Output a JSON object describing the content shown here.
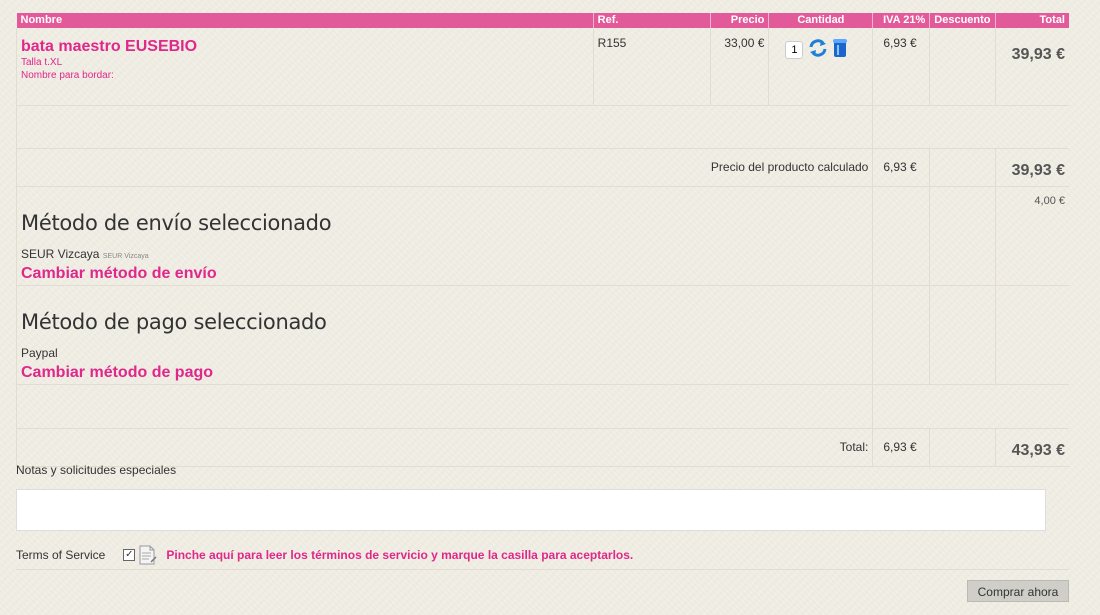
{
  "columns": {
    "name": "Nombre",
    "ref": "Ref.",
    "price": "Precio",
    "qty": "Cantidad",
    "tax": "IVA 21%",
    "discount": "Descuento",
    "total": "Total"
  },
  "product": {
    "name": "bata maestro EUSEBIO",
    "size": "Talla t.XL",
    "embroidery": "Nombre para bordar:",
    "ref": "R155",
    "price": "33,00 €",
    "quantity": "1",
    "tax": "6,93 €",
    "total": "39,93 €"
  },
  "calc": {
    "label": "Precio del producto calculado",
    "tax": "6,93 €",
    "total": "39,93 €"
  },
  "shipping": {
    "title": "Método de envío seleccionado",
    "method": "SEUR Vizcaya",
    "method_small": "SEUR Vizcaya",
    "change_link": "Cambiar método de envío",
    "cost": "4,00 €"
  },
  "payment": {
    "title": "Método de pago seleccionado",
    "method": "Paypal",
    "change_link": "Cambiar método de pago"
  },
  "grand": {
    "label": "Total:",
    "tax": "6,93 €",
    "total": "43,93 €"
  },
  "notes": {
    "label": "Notas y solicitudes especiales",
    "value": ""
  },
  "tos": {
    "label": "Terms of Service",
    "checked": true,
    "link": "Pinche aquí para leer los términos de servicio y marque la casilla para aceptarlos."
  },
  "buy_button": "Comprar ahora",
  "icons": {
    "refresh": "refresh-icon",
    "delete": "trash-icon",
    "document": "document-icon"
  },
  "colors": {
    "accent": "#e0278a",
    "header": "#e35a9b"
  }
}
